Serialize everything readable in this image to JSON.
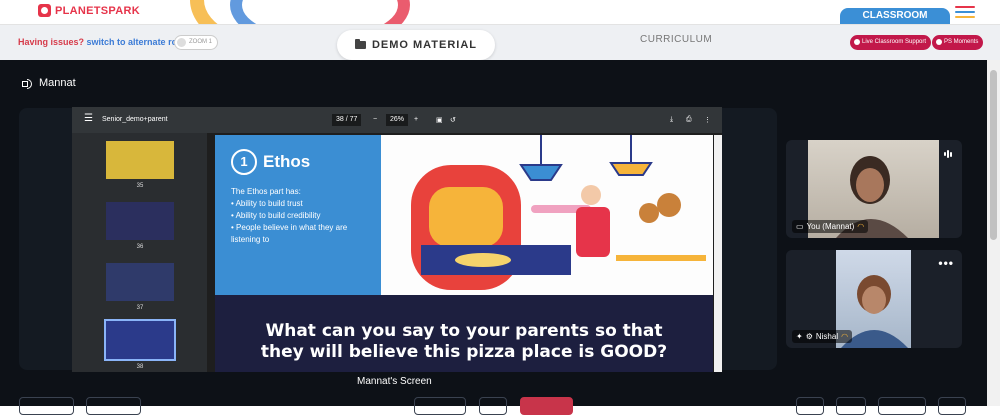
{
  "brand": {
    "logo_text": "PLANETSPARK",
    "accent": "#e6344a"
  },
  "header": {
    "classroom_tab": "CLASSROOM"
  },
  "subbar": {
    "issues_label": "Having issues?",
    "switch_link": "switch to alternate room",
    "toggle_label": "ZOOM 1",
    "demo_button": "DEMO MATERIAL",
    "curriculum_tab": "CURRICULUM",
    "support_pill": "Live Classroom Support",
    "moments_pill": "PS Moments"
  },
  "stage": {
    "speaker_name": "Mannat",
    "caption": "Mannat's Screen"
  },
  "pdf": {
    "file_name": "Senior_demo+parent",
    "page": "38",
    "page_sep": "/",
    "page_total": "77",
    "zoom": "26%",
    "thumbs": [
      {
        "num": "35",
        "color": "#d8b73b"
      },
      {
        "num": "36",
        "color": "#2b2f5e"
      },
      {
        "num": "37",
        "color": "#2f3a6a"
      },
      {
        "num": "38",
        "color": "#2b3a8a"
      }
    ],
    "slide": {
      "number": "1",
      "heading": "Ethos",
      "intro": "The Ethos part has:",
      "bullets": [
        "Ability to build trust",
        "Ability to build credibility",
        "People believe in what they are listening to"
      ],
      "question_line1": "What can you say to your parents so that",
      "question_line2": "they will believe this pizza place is GOOD?"
    }
  },
  "participants": [
    {
      "name": "You (Mannat)"
    },
    {
      "name": "Nishal"
    }
  ],
  "colors": {
    "stage_bg": "#0d1117",
    "tile_bg": "#1b2029",
    "pill": "#c2184a",
    "tab": "#3b8fd6"
  }
}
